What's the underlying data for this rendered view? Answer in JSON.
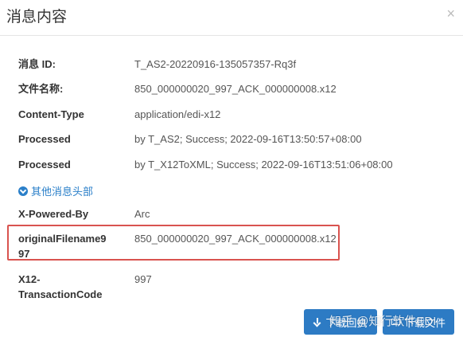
{
  "header": {
    "title": "消息内容",
    "close_glyph": "×"
  },
  "fields": [
    {
      "label": "消息 ID:",
      "value": "T_AS2-20220916-135057357-Rq3f"
    },
    {
      "label": "文件名称:",
      "value": "850_000000020_997_ACK_000000008.x12"
    },
    {
      "label": "Content-Type",
      "value": "application/edi-x12"
    },
    {
      "label": "Processed",
      "value": "by T_AS2; Success; 2022-09-16T13:50:57+08:00"
    },
    {
      "label": "Processed",
      "value": "by T_X12ToXML; Success; 2022-09-16T13:51:06+08:00"
    }
  ],
  "toggle": {
    "label": "其他消息头部",
    "icon": "chevron-circle-down-icon"
  },
  "extra_fields": [
    {
      "label": "X-Powered-By",
      "value": "Arc"
    },
    {
      "label_line1": "originalFilename9",
      "label_line2": "97",
      "value": "850_000000020_997_ACK_000000008.x12"
    },
    {
      "label_line1": "X12-",
      "label_line2": "TransactionCode",
      "value": "997"
    }
  ],
  "buttons": {
    "download_ack": "下载回执",
    "download_file": "下载文件"
  },
  "watermark": "知乎 @知行软件EDI",
  "colors": {
    "accent": "#2d7bc4",
    "link": "#2a7fc9",
    "highlight": "#d9534f"
  }
}
